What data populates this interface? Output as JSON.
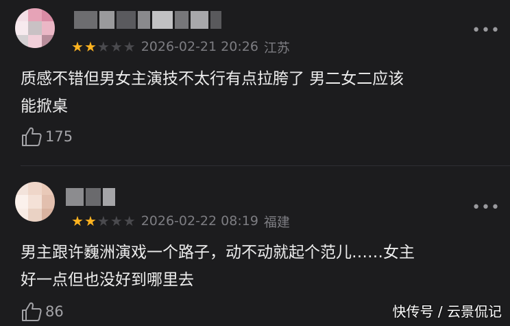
{
  "comments": [
    {
      "rating": 2,
      "max_rating": 5,
      "date": "2026-02-21 20:26",
      "location": "江苏",
      "text": "质感不错但男女主演技不太行有点拉胯了 男二女二应该\n能掀桌",
      "likes": "175",
      "avatar_colors": [
        "#f3dfe6",
        "#e6a3b7",
        "#d98ba4",
        "#f7eaee",
        "#c9c1c4",
        "#ebb7c6",
        "#d4d0d2",
        "#f1cfd9",
        "#b88d9b"
      ],
      "username_colors": [
        "#6d6d70",
        "#9a9a9c",
        "#5a5a5e",
        "#8a8a8d",
        "#c1c1c3",
        "#77777a",
        "#a8a8ab",
        "#59595c"
      ]
    },
    {
      "rating": 2,
      "max_rating": 5,
      "date": "2026-02-22 08:19",
      "location": "福建",
      "text": "男主跟许巍洲演戏一个路子，动不动就起个范儿……女主\n好一点但也没好到哪里去",
      "likes": "86",
      "avatar_colors": [
        "#f3e3db",
        "#efd6c9",
        "#e9c9b8",
        "#fbf1ec",
        "#f4e1d7",
        "#e2bfae",
        "#f8ece5",
        "#ead2c4",
        "#d9b3a0"
      ],
      "username_colors": [
        "#8c8c8f",
        "#6a6a6d",
        "#a5a5a8"
      ]
    }
  ],
  "more_label": "•••",
  "watermark": "快传号 / 云景侃记",
  "colors": {
    "background": "#1c1c1e",
    "star_on": "#ffb320",
    "star_off": "#4a4a4e",
    "meta_text": "#7d7d82"
  }
}
